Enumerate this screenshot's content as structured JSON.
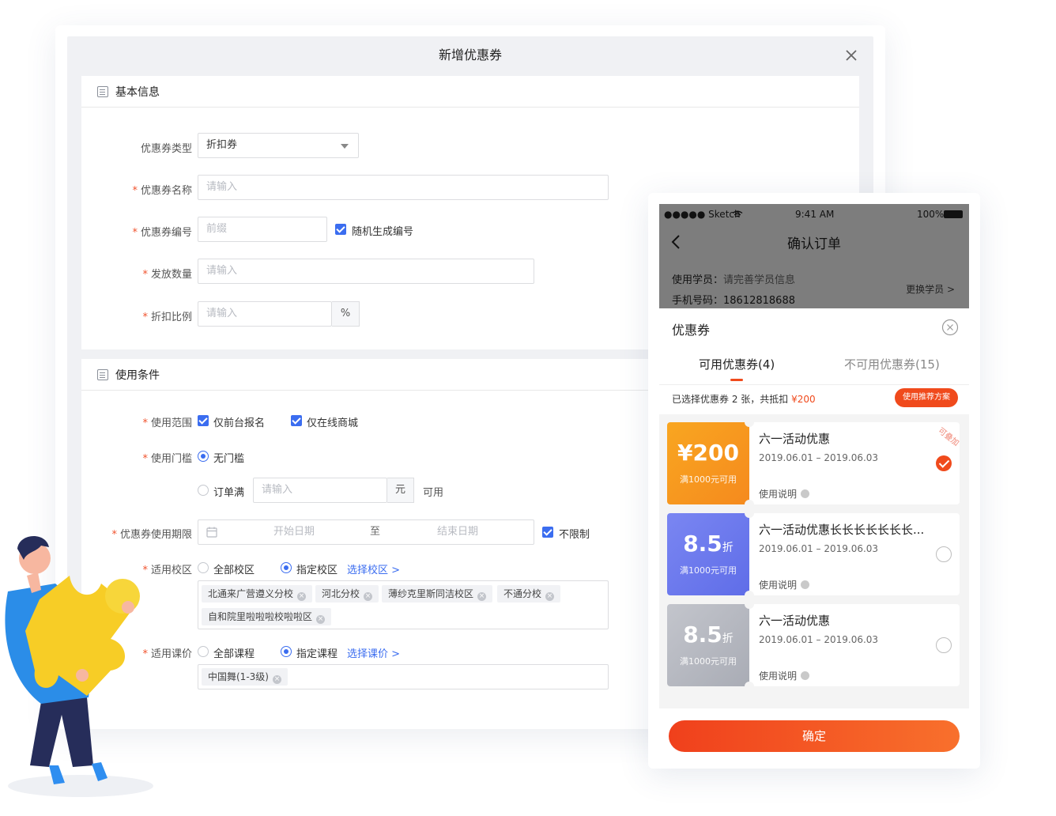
{
  "modal": {
    "title": "新增优惠券",
    "basic_section": "基本信息",
    "usage_section": "使用条件",
    "fields": {
      "type_label": "优惠券类型",
      "type_value": "折扣券",
      "name_label": "优惠券名称",
      "name_placeholder": "请输入",
      "code_label": "优惠券编号",
      "code_placeholder": "前缀",
      "code_random": "随机生成编号",
      "qty_label": "发放数量",
      "qty_placeholder": "请输入",
      "ratio_label": "折扣比例",
      "ratio_placeholder": "请输入",
      "ratio_suffix": "%"
    },
    "usage": {
      "scope_label": "使用范围",
      "scope_opt1": "仅前台报名",
      "scope_opt2": "仅在线商城",
      "threshold_label": "使用门槛",
      "threshold_none": "无门槛",
      "threshold_order": "订单满",
      "threshold_placeholder": "请输入",
      "threshold_unit": "元",
      "threshold_after": "可用",
      "period_label": "优惠券使用期限",
      "period_start": "开始日期",
      "period_to": "至",
      "period_end": "结束日期",
      "period_unlimited": "不限制",
      "campus_label": "适用校区",
      "campus_all": "全部校区",
      "campus_specific": "指定校区",
      "campus_select": "选择校区 >",
      "campus_tags": [
        "北通来广营遵义分校",
        "河北分校",
        "薄纱克里斯同洁校区",
        "不通分校",
        "自和院里啦啦啦校啦啦区"
      ],
      "course_label": "适用课价",
      "course_all": "全部课程",
      "course_specific": "指定课程",
      "course_select": "选择课价 >",
      "course_tags": [
        "中国舞(1-3级)"
      ]
    }
  },
  "phone": {
    "status_carrier": "●●●●● Sketch",
    "status_time": "9:41 AM",
    "status_battery": "100%",
    "nav_title": "确认订单",
    "student_label": "使用学员：",
    "student_value": "请完善学员信息",
    "phone_label": "手机号码：",
    "phone_value": "18612818688",
    "change_student": "更换学员 >",
    "sheet_title": "优惠券",
    "tab_available": "可用优惠券(4)",
    "tab_unavailable": "不可用优惠券(15)",
    "selected_text": "已选择优惠券 2 张，共抵扣",
    "selected_amount": "¥200",
    "recommend_btn": "使用推荐方案",
    "coupons": [
      {
        "amount": "¥200",
        "unit": "",
        "condition": "满1000元可用",
        "name": "六一活动优惠",
        "date": "2019.06.01 – 2019.06.03",
        "desc": "使用说明",
        "badge": "可叠加",
        "selected": true
      },
      {
        "amount": "8.5",
        "unit": "折",
        "condition": "满1000元可用",
        "name": "六一活动优惠长长长长长长长...",
        "date": "2019.06.01 – 2019.06.03",
        "desc": "使用说明",
        "badge": "",
        "selected": false
      },
      {
        "amount": "8.5",
        "unit": "折",
        "condition": "满1000元可用",
        "name": "六一活动优惠",
        "date": "2019.06.01 – 2019.06.03",
        "desc": "使用说明",
        "badge": "",
        "selected": false
      }
    ],
    "confirm_btn": "确定"
  },
  "colors": {
    "primary_blue": "#3b6df0",
    "accent_red": "#f04a1c",
    "coupon_orange": "#f59a1f",
    "coupon_blue": "#6a77f0",
    "coupon_grey": "#b9bcc4"
  }
}
